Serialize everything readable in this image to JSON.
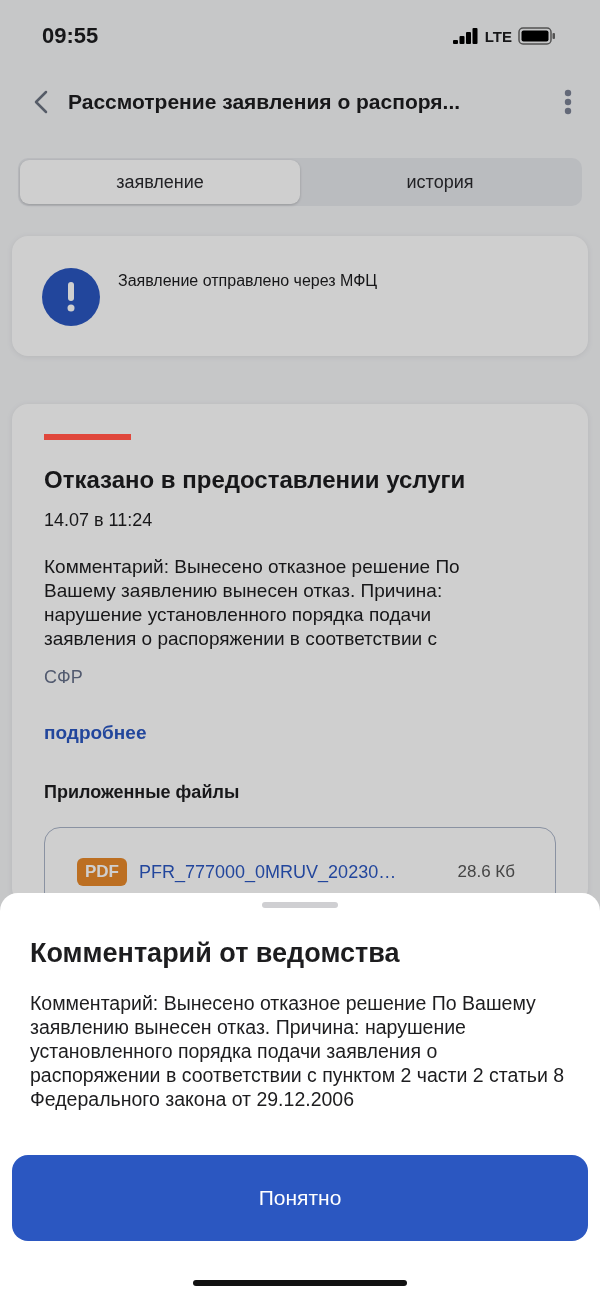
{
  "status_bar": {
    "time": "09:55",
    "network": "LTE"
  },
  "header": {
    "title": "Рассмотрение заявления о распоря..."
  },
  "tabs": [
    {
      "label": "заявление",
      "selected": true
    },
    {
      "label": "история",
      "selected": false
    }
  ],
  "notice": {
    "text": "Заявление отправлено через МФЦ"
  },
  "status_card": {
    "color": "#e0473c",
    "title": "Отказано в предоставлении услуги",
    "date": "14.07 в 11:24",
    "comment": "Комментарий: Вынесено отказное решение По Вашему заявлению вынесен отказ. Причина: нарушение установленного порядка подачи заявления о распоряжении в соответствии с",
    "agency": "СФР",
    "more_link": "подробнее",
    "files_title": "Приложенные файлы",
    "files": [
      {
        "type": "PDF",
        "name": "PFR_777000_0MRUV_20230…",
        "size": "28.6 Кб"
      }
    ]
  },
  "sheet": {
    "title": "Комментарий от ведомства",
    "text": "Комментарий: Вынесено отказное решение По Вашему заявлению вынесен отказ. Причина: нарушение установленного порядка подачи заявления о распоряжении в соответствии с пунктом 2 части 2 статьи 8 Федерального закона от 29.12.2006",
    "button": "Понятно"
  }
}
